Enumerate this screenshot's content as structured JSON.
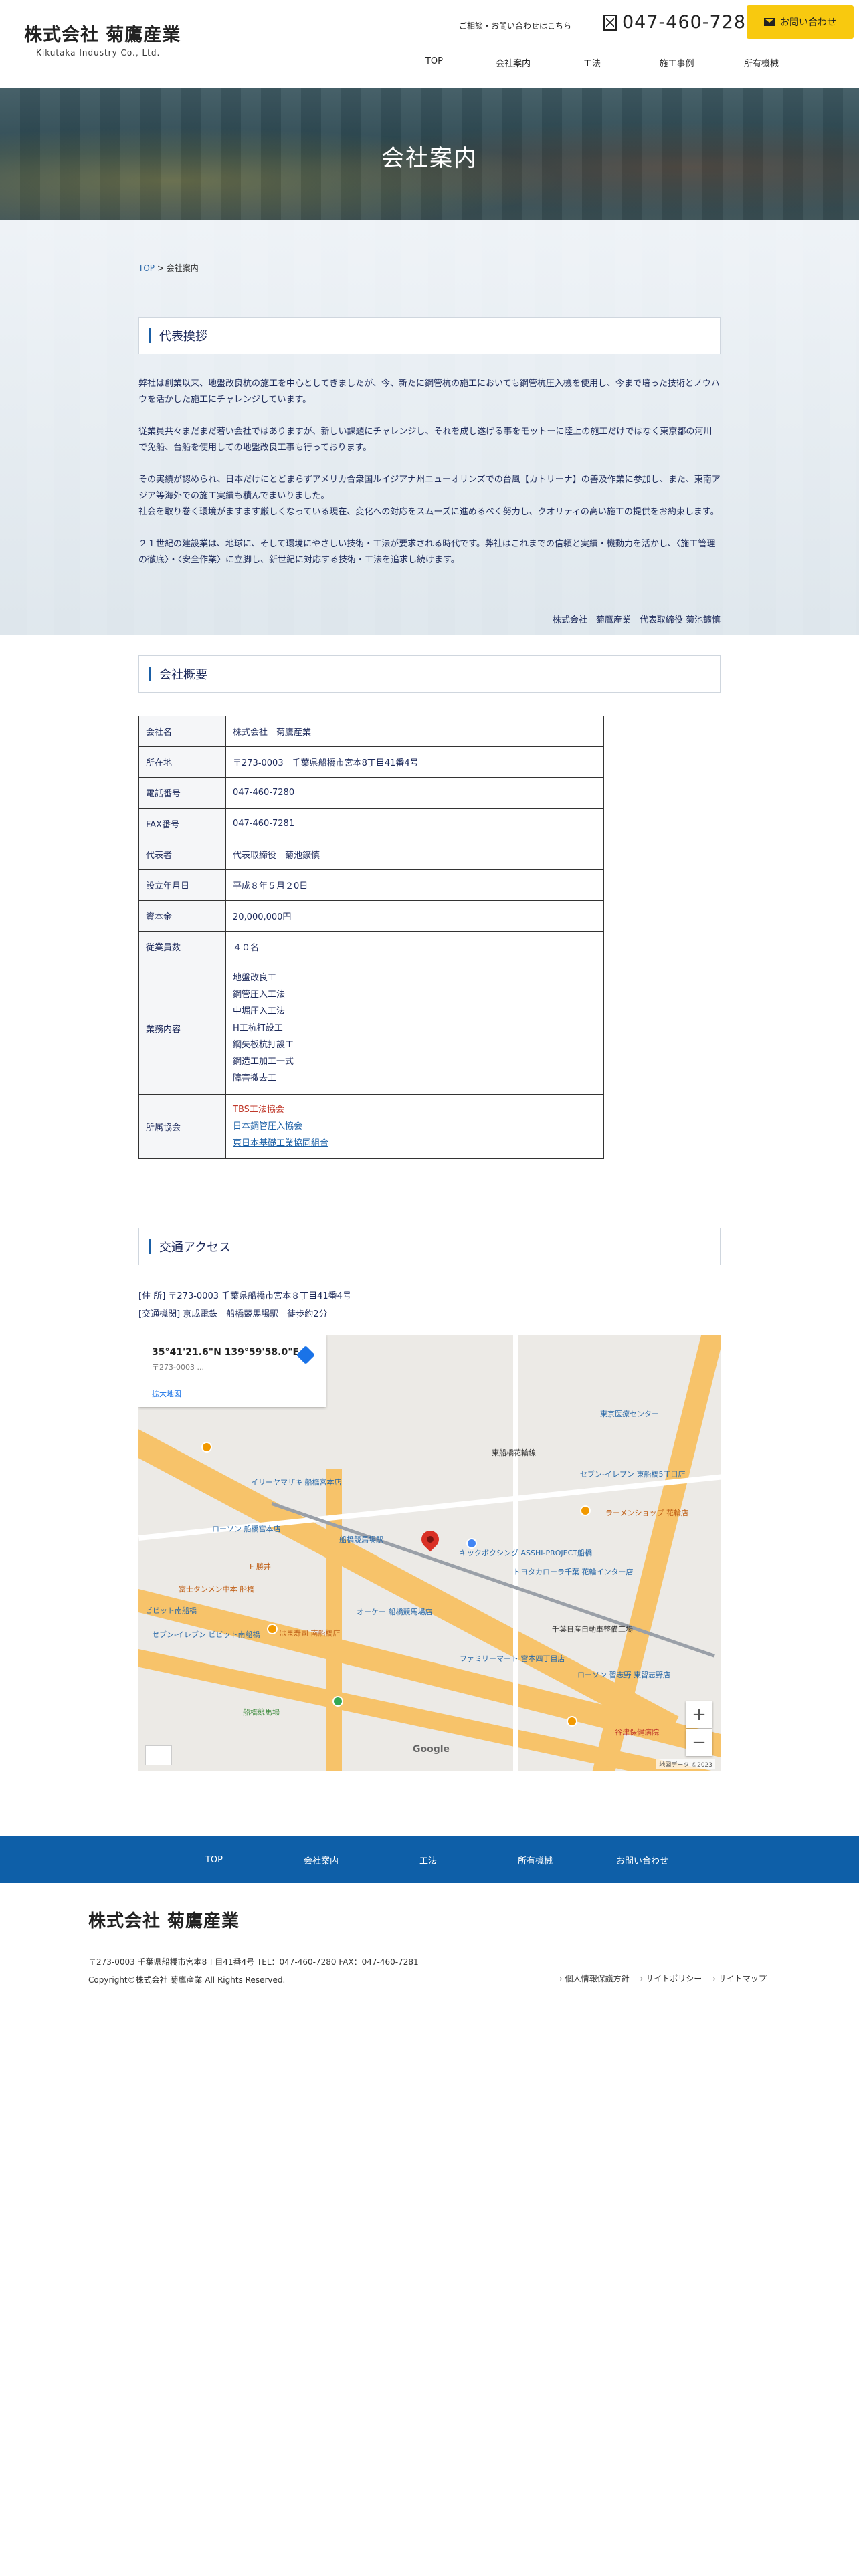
{
  "header": {
    "logo": "株式会社 菊鷹産業",
    "logo_sub": "Kikutaka Industry Co., Ltd.",
    "contact_note": "ご相談・お問い合わせはこちら",
    "phone": "047-460-7280",
    "contact_button": "お問い合わせ",
    "nav": [
      "TOP",
      "会社案内",
      "工法",
      "施工事例",
      "所有機械"
    ]
  },
  "hero": {
    "title": "会社案内"
  },
  "breadcrumb": {
    "home": "TOP",
    "separator": ">",
    "current": "会社案内"
  },
  "greeting": {
    "heading": "代表挨拶",
    "paragraphs": [
      "弊社は創業以来、地盤改良杭の施工を中心としてきましたが、今、新たに鋼管杭の施工においても鋼管杭圧入機を使用し、今まで培った技術とノウハウを活かした施工にチャレンジしています。",
      "従業員共々まだまだ若い会社ではありますが、新しい課題にチャレンジし、それを成し遂げる事をモットーに陸上の施工だけではなく東京都の河川で免船、台船を使用しての地盤改良工事も行っております。",
      "その実績が認められ、日本だけにとどまらずアメリカ合衆国ルイジアナ州ニューオリンズでの台風【カトリーナ】の善及作業に参加し、また、東南アジア等海外での施工実績も積んでまいりました。\n社会を取り巻く環境がますます厳しくなっている現在、変化への対応をスムーズに進めるべく努力し、クオリティの高い施工の提供をお約束します。",
      "２１世紀の建設業は、地球に、そして環境にやさしい技術・工法が要求される時代です。弊社はこれまでの信頼と実績・機動力を活かし、〈施工管理の徹底〉・〈安全作業〉に立脚し、新世紀に対応する技術・工法を追求し続けます。"
    ],
    "signature": "株式会社　菊鷹産業　代表取締役 菊池鑛慎"
  },
  "overview": {
    "heading": "会社概要",
    "rows": [
      {
        "label": "会社名",
        "value": "株式会社　菊鷹産業"
      },
      {
        "label": "所在地",
        "value": "〒273-0003　千葉県船橋市宮本8丁目41番4号"
      },
      {
        "label": "電話番号",
        "value": "047-460-7280"
      },
      {
        "label": "FAX番号",
        "value": "047-460-7281"
      },
      {
        "label": "代表者",
        "value": "代表取締役　菊池鑛慎"
      },
      {
        "label": "設立年月日",
        "value": "平成８年５月２0日"
      },
      {
        "label": "資本金",
        "value": "20,000,000円"
      },
      {
        "label": "従業員数",
        "value": "４０名"
      }
    ],
    "business_label": "業務内容",
    "business": [
      "地盤改良工",
      "鋼管圧入工法",
      "中堀圧入工法",
      "H工杭打設工",
      "鋼矢板杭打設工",
      "鋼造工加工一式",
      "障害撤去工"
    ],
    "assoc_label": "所属協会",
    "associations": [
      "TBS工法協会",
      "日本鋼管圧入協会",
      "東日本基礎工業協同組合"
    ]
  },
  "access": {
    "heading": "交通アクセス",
    "address": "[住 所] 〒273-0003 千葉県船橋市宮本８丁目41番4号",
    "transport": "[交通機関] 京成電鉄　船橋競馬場駅　徒歩約2分"
  },
  "map": {
    "coord": "35°41'21.6\"N 139°59'58.0\"E",
    "addr": "〒273-0003 ...",
    "enlarge": "拡大地図",
    "brand": "Google",
    "credits": "地図データ ©2023",
    "zoom_in": "+",
    "zoom_out": "−",
    "labels": {
      "l1": "東京医療センター",
      "l2": "東船橋花輪線",
      "l3": "セブン-イレブン 東船橋5丁目店",
      "l4": "ラーメンショップ 花輪店",
      "l5": "イリーヤマザキ 船橋宮本店",
      "l6": "キックボクシング ASSHI-PROJECT船橋",
      "l7": "トヨタカローラ千葉 花輪インター店",
      "l8": "船橋競馬場駅",
      "l9": "ローソン 船橋宮本店",
      "l10": "F 勝井",
      "l11": "富士タンメン中本 船橋",
      "l12": "ビビット南船橋",
      "l13": "セブン-イレブン ビビット南船橋",
      "l14": "はま寿司 南船橋店",
      "l15": "オーケー 船橋競馬場店",
      "l16": "船橋競馬場",
      "l17": "千葉日産自動車整備工場",
      "l18": "ファミリーマート 宮本四丁目店",
      "l19": "ローソン 習志野 東習志野店",
      "l20": "谷津保健病院"
    }
  },
  "footer": {
    "nav": [
      "TOP",
      "会社案内",
      "工法",
      "所有機械",
      "お問い合わせ"
    ],
    "logo": "株式会社 菊鷹産業",
    "address": "〒273-0003 千葉県船橋市宮本8丁目41番4号 TEL：047-460-7280  FAX：047-460-7281",
    "copyright": "Copyright©株式会社 菊鷹産業 All Rights Reserved.",
    "links": [
      "個人情報保護方針",
      "サイトポリシー",
      "サイトマップ"
    ]
  }
}
